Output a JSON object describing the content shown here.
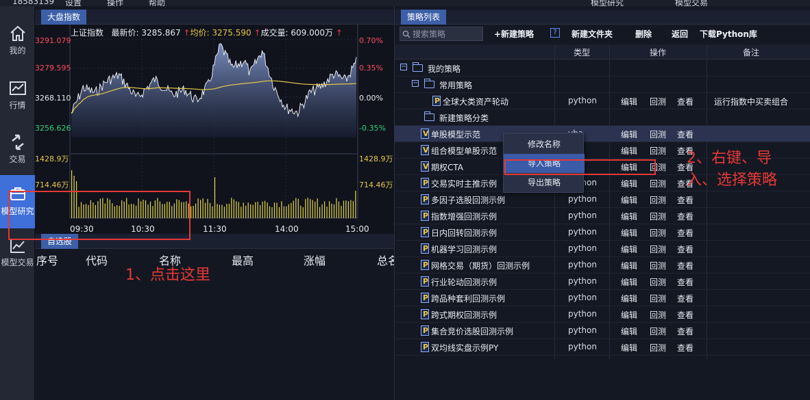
{
  "topbar": {
    "account": "18583139",
    "items": [
      "设置",
      "操作",
      "帮助"
    ],
    "right_items": [
      "模型研究",
      "模型交易"
    ]
  },
  "nav": [
    {
      "label": "我的",
      "icon": "home-icon"
    },
    {
      "label": "行情",
      "icon": "chart-icon"
    },
    {
      "label": "交易",
      "icon": "trade-arrows-icon"
    },
    {
      "label": "模型研究",
      "icon": "model-research-icon",
      "active": true
    },
    {
      "label": "模型交易",
      "icon": "model-trade-icon"
    }
  ],
  "market": {
    "tab": "大盘指数",
    "index_name": "上证指数",
    "latest_label": "最新价:",
    "latest_value": "3285.867",
    "avg_label": "均价:",
    "avg_value": "3275.590",
    "volume_label": "成交量:",
    "volume_value": "609.000万",
    "price_ticks_left": [
      "3291.079",
      "3279.595",
      "3268.110",
      "3256.626"
    ],
    "pct_ticks_right": [
      "0.70%",
      "0.35%",
      "0.00%",
      "-0.35%"
    ],
    "vol_ticks": [
      "1428.9万",
      "714.46万"
    ],
    "time_ticks": [
      "09:30",
      "10:30",
      "11:30",
      "14:00",
      "15:00"
    ],
    "colors": {
      "up": "#ff4d5e",
      "down": "#39d07a",
      "flat": "#e8eaf0",
      "avg_line": "#e6c84a",
      "volume": "#e6d84a"
    }
  },
  "watchlist": {
    "tab": "自选股",
    "columns": [
      "序号",
      "代码",
      "名称",
      "最高",
      "涨幅",
      "总名"
    ]
  },
  "strategy": {
    "tab": "策略列表",
    "search_placeholder": "搜索策略",
    "toolbar": {
      "new_strategy": "+新建策略",
      "help": "?",
      "new_folder": "新建文件夹",
      "delete": "删除",
      "back": "返回",
      "download": "下载Python库"
    },
    "columns": {
      "type": "类型",
      "ops": "操作",
      "note": "备注"
    },
    "ops": {
      "edit": "编辑",
      "backtest": "回测",
      "view": "查看"
    },
    "rows": [
      {
        "kind": "folder",
        "level": 0,
        "name": "我的策略",
        "expander": "⊟"
      },
      {
        "kind": "folder",
        "level": 1,
        "name": "常用策略",
        "expander": "⊟"
      },
      {
        "kind": "file",
        "level": 2,
        "icon": "P",
        "name": "全球大类资产轮动",
        "type": "python",
        "note": "运行指数中买卖组合"
      },
      {
        "kind": "folder",
        "level": 1,
        "name": "新建策略分类"
      },
      {
        "kind": "file",
        "level": 1,
        "icon": "V",
        "name": "单股模型示范",
        "type": "vba",
        "selected": true
      },
      {
        "kind": "file",
        "level": 1,
        "icon": "V",
        "name": "组合模型单股示范",
        "type": "vba"
      },
      {
        "kind": "file",
        "level": 1,
        "icon": "V",
        "name": "期权CTA",
        "type": "vba"
      },
      {
        "kind": "file",
        "level": 1,
        "icon": "P",
        "name": "交易实时主推示例",
        "type": "python"
      },
      {
        "kind": "file",
        "level": 1,
        "icon": "P",
        "name": "多因子选股回测示例",
        "type": "python"
      },
      {
        "kind": "file",
        "level": 1,
        "icon": "P",
        "name": "指数增强回测示例",
        "type": "python"
      },
      {
        "kind": "file",
        "level": 1,
        "icon": "P",
        "name": "日内回转回测示例",
        "type": "python"
      },
      {
        "kind": "file",
        "level": 1,
        "icon": "P",
        "name": "机器学习回测示例",
        "type": "python"
      },
      {
        "kind": "file",
        "level": 1,
        "icon": "P",
        "name": "网格交易（期货）回测示例",
        "type": "python"
      },
      {
        "kind": "file",
        "level": 1,
        "icon": "P",
        "name": "行业轮动回测示例",
        "type": "python"
      },
      {
        "kind": "file",
        "level": 1,
        "icon": "P",
        "name": "跨品种套利回测示例",
        "type": "python"
      },
      {
        "kind": "file",
        "level": 1,
        "icon": "P",
        "name": "跨式期权回测示例",
        "type": "python"
      },
      {
        "kind": "file",
        "level": 1,
        "icon": "P",
        "name": "集合竞价选股回测示例",
        "type": "python"
      },
      {
        "kind": "file",
        "level": 1,
        "icon": "P",
        "name": "双均线实盘示例PY",
        "type": "python"
      }
    ]
  },
  "context_menu": {
    "items": [
      "修改名称",
      "导入策略",
      "导出策略"
    ],
    "highlighted_index": 1
  },
  "annotations": {
    "step1": "1、点击这里",
    "step2_line1": "2、右键、导",
    "step2_line2": "入、选择策略"
  }
}
